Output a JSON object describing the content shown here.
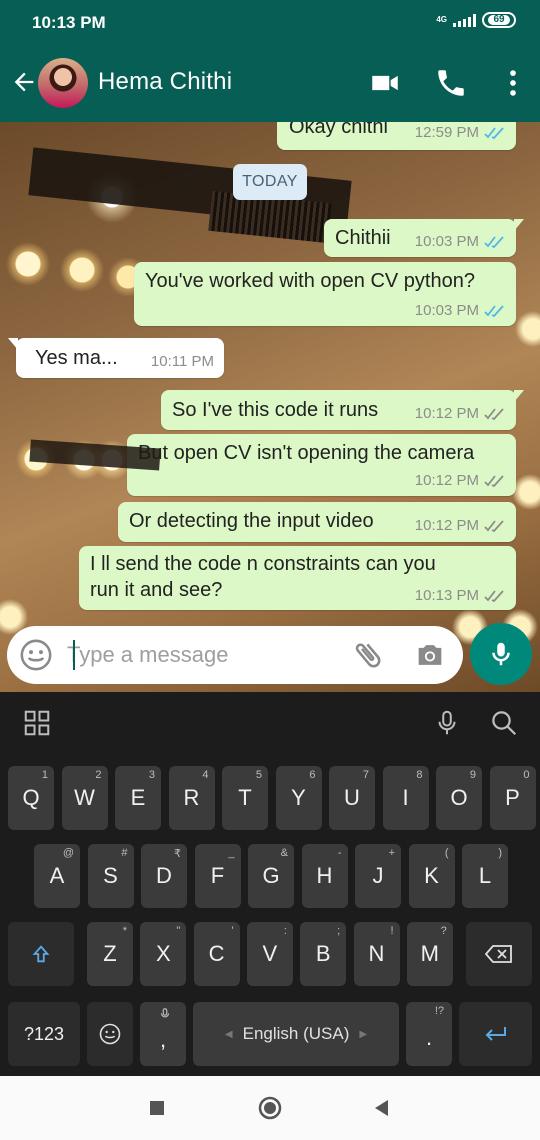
{
  "status_bar": {
    "time": "10:13 PM",
    "network": "4G",
    "battery": "69"
  },
  "header": {
    "contact_name": "Hema Chithi"
  },
  "chat": {
    "date_chip": "TODAY",
    "messages": [
      {
        "text": "Okay chithi",
        "time": "12:59 PM",
        "direction": "out",
        "status": "read"
      },
      {
        "text": "Chithii",
        "time": "10:03 PM",
        "direction": "out",
        "status": "read"
      },
      {
        "text": "You've worked with open CV python?",
        "time": "10:03 PM",
        "direction": "out",
        "status": "read"
      },
      {
        "text": "Yes ma...",
        "time": "10:11 PM",
        "direction": "in"
      },
      {
        "text": "So I've this code it runs",
        "time": "10:12 PM",
        "direction": "out",
        "status": "delivered"
      },
      {
        "text": "But open CV isn't opening the camera",
        "time": "10:12 PM",
        "direction": "out",
        "status": "delivered"
      },
      {
        "text": "Or detecting the input video",
        "time": "10:12 PM",
        "direction": "out",
        "status": "delivered"
      },
      {
        "text_line1": "I ll send the code n constraints can you",
        "text_line2": "run it and see?",
        "time": "10:13 PM",
        "direction": "out",
        "status": "delivered"
      }
    ],
    "colors": {
      "read_ticks": "#4fb6ec",
      "delivered_ticks": "#8c8c8c",
      "outgoing_bubble": "#dcf8c6",
      "header": "#075e54",
      "mic_button": "#00897b"
    }
  },
  "composer": {
    "placeholder": "Type a message"
  },
  "keyboard": {
    "row1": [
      {
        "k": "Q",
        "s": "1"
      },
      {
        "k": "W",
        "s": "2"
      },
      {
        "k": "E",
        "s": "3"
      },
      {
        "k": "R",
        "s": "4"
      },
      {
        "k": "T",
        "s": "5"
      },
      {
        "k": "Y",
        "s": "6"
      },
      {
        "k": "U",
        "s": "7"
      },
      {
        "k": "I",
        "s": "8"
      },
      {
        "k": "O",
        "s": "9"
      },
      {
        "k": "P",
        "s": "0"
      }
    ],
    "row2": [
      {
        "k": "A",
        "s": "@"
      },
      {
        "k": "S",
        "s": "#"
      },
      {
        "k": "D",
        "s": "₹"
      },
      {
        "k": "F",
        "s": "_"
      },
      {
        "k": "G",
        "s": "&"
      },
      {
        "k": "H",
        "s": "-"
      },
      {
        "k": "J",
        "s": "+"
      },
      {
        "k": "K",
        "s": "("
      },
      {
        "k": "L",
        "s": ")"
      }
    ],
    "row3": [
      {
        "k": "Z",
        "s": "*"
      },
      {
        "k": "X",
        "s": "\""
      },
      {
        "k": "C",
        "s": "'"
      },
      {
        "k": "V",
        "s": ":"
      },
      {
        "k": "B",
        "s": ";"
      },
      {
        "k": "N",
        "s": "!"
      },
      {
        "k": "M",
        "s": "?"
      }
    ],
    "symbols_label": "?123",
    "comma_label": ",",
    "period_label": ".",
    "period_sub": "!?",
    "space_label": "English (USA)"
  }
}
